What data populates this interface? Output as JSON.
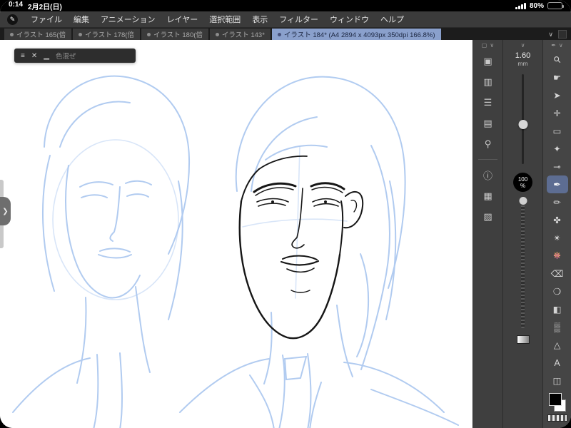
{
  "status_bar": {
    "time": "0:14",
    "date": "2月2日(日)",
    "battery_percent": "80%"
  },
  "menu_bar": {
    "logo_glyph": "✎",
    "items": [
      "ファイル",
      "編集",
      "アニメーション",
      "レイヤー",
      "選択範囲",
      "表示",
      "フィルター",
      "ウィンドウ",
      "ヘルプ"
    ]
  },
  "tab_bar": {
    "tabs": [
      {
        "label": "イラスト 165(倍"
      },
      {
        "label": "イラスト 178(倍"
      },
      {
        "label": "イラスト 180(倍"
      },
      {
        "label": "イラスト 143*"
      },
      {
        "label": "イラスト 184* (A4 2894 x 4093px 350dpi 166.8%)"
      }
    ],
    "active_index": 4
  },
  "floating_panel": {
    "title": "色混ぜ",
    "icons": [
      "≡",
      "✕",
      "▁"
    ]
  },
  "left_handle": {
    "chevron": "❯"
  },
  "ui": {
    "chevron_down": "∨",
    "panel_box": "▢",
    "pen_head": "✒"
  },
  "right_panel": {
    "brush_size_value": "1.60",
    "brush_size_unit": "mm",
    "opacity_value": "100",
    "opacity_unit": "%",
    "panel_icons": [
      {
        "name": "canvas-thumbnail-panel-icon",
        "glyph": "▣"
      },
      {
        "name": "sub-view-panel-icon",
        "glyph": "▥"
      },
      {
        "name": "tool-property-panel-icon",
        "glyph": "☰"
      },
      {
        "name": "brush-settings-panel-icon",
        "glyph": "▤"
      },
      {
        "name": "sub-tool-detail-panel-icon",
        "glyph": "⚲"
      },
      {
        "name": "info-panel-icon",
        "glyph": "ⓘ"
      },
      {
        "name": "color-set-panel-icon",
        "glyph": "▦"
      },
      {
        "name": "material-panel-icon",
        "glyph": "▨"
      }
    ],
    "tools": [
      {
        "name": "zoom-tool",
        "glyph": "⚲"
      },
      {
        "name": "move-view-tool",
        "glyph": "☛"
      },
      {
        "name": "operate-tool",
        "glyph": "➤"
      },
      {
        "name": "layer-move-tool",
        "glyph": "✛"
      },
      {
        "name": "selection-tool",
        "glyph": "▭"
      },
      {
        "name": "auto-select-tool",
        "glyph": "✦"
      },
      {
        "name": "eyedropper-tool",
        "glyph": "⊸"
      },
      {
        "name": "pen-tool",
        "glyph": "✒"
      },
      {
        "name": "pencil-tool",
        "glyph": "✏"
      },
      {
        "name": "brush-tool",
        "glyph": "✤"
      },
      {
        "name": "airbrush-tool",
        "glyph": "✴"
      },
      {
        "name": "decoration-tool",
        "glyph": "❈"
      },
      {
        "name": "eraser-tool",
        "glyph": "⌫"
      },
      {
        "name": "blend-tool",
        "glyph": "❍"
      },
      {
        "name": "fill-tool",
        "glyph": "◧"
      },
      {
        "name": "gradient-tool",
        "glyph": "▒"
      },
      {
        "name": "figure-tool",
        "glyph": "△"
      },
      {
        "name": "text-tool",
        "glyph": "A"
      },
      {
        "name": "frame-tool",
        "glyph": "◫"
      }
    ],
    "selected_tool_index": 7
  },
  "colors": {
    "active_tab": "#8aa0cc",
    "selected_tool": "#5d6d92",
    "sketch_blue": "#a9c6ef",
    "ink_black": "#161616",
    "main_color": "#000000",
    "sub_color": "#ffffff"
  }
}
